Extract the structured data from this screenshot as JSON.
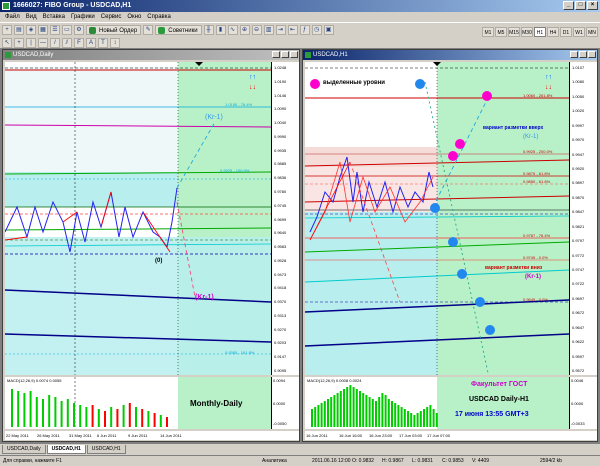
{
  "app": {
    "title": "1666027: FIBO Group - USDCAD,H1"
  },
  "menu": [
    "Файл",
    "Вид",
    "Вставка",
    "Графики",
    "Сервис",
    "Окно",
    "Справка"
  ],
  "toolbar": {
    "new_order_label": "Новый Ордер",
    "advisors_label": "Советники"
  },
  "timeframes": [
    "M1",
    "M5",
    "M15",
    "M30",
    "H1",
    "H4",
    "D1",
    "W1",
    "MN"
  ],
  "active_timeframe": "H1",
  "left_chart": {
    "title": "USDCAD,Daily",
    "price_labels": [
      "1.0248",
      "1.0190",
      "1.0146",
      "1.0090",
      "1.0040",
      "0.9990",
      "0.9935",
      "0.9885",
      "0.9836",
      "0.9780",
      "0.9745",
      "0.9699",
      "0.9640",
      "0.9583",
      "0.9528",
      "0.9473",
      "0.9418",
      "0.9370",
      "0.9313",
      "0.9270",
      "0.9203",
      "0.9147",
      "0.9095"
    ],
    "level_labels": [
      "1.0150 - 76.4%",
      "0.9925 - 100.0%",
      "0.9385 - 161.8%"
    ],
    "label_kr": "(Kr-1)",
    "label_zero": "(0)",
    "label_kr2": "(Kr-1)",
    "macd_label": "MACD(12,26,9) 0.0074 0.0055",
    "macd_scale": [
      "0.0094",
      "0.0000",
      "-0.0050"
    ],
    "dates": [
      "22 May 2011",
      "26 May 2011",
      "31 May 2011",
      "6 Jun 2011",
      "9 Jun 2011",
      "14 Jun 2011"
    ],
    "overlay_text": "Monthly-Daily"
  },
  "right_chart": {
    "title": "USDCAD,H1",
    "price_labels": [
      "1.0107",
      "1.0080",
      "1.0050",
      "1.0020",
      "0.9997",
      "0.9970",
      "0.9947",
      "0.9920",
      "0.9897",
      "0.9870",
      "0.9847",
      "0.9821",
      "0.9797",
      "0.9772",
      "0.9747",
      "0.9722",
      "0.9697",
      "0.9672",
      "0.9647",
      "0.9622",
      "0.9597",
      "0.9572"
    ],
    "level_labels": [
      "1.0060 - 261.8%",
      "0.9925 - 200.0%",
      "0.9875 - 61.8%",
      "0.9850 - 61.8%",
      "0.9787 - 76.4%",
      "0.9745 - 0.0%",
      "0.9645 - 0.0%"
    ],
    "legend_text": "выделенные уровни",
    "label_up": "вариант разметки вверх",
    "label_kr": "(Kr-1)",
    "label_down": "вариант разметки вниз",
    "label_kr2": "(Kr-1)",
    "macd_label": "MACD(12,26,9) 0.0008 0.0024",
    "macd_scale": [
      "0.0046",
      "0.0000",
      "-0.0033"
    ],
    "dates": [
      "16 Jun 2011",
      "16 Jun 16:00",
      "16 Jun 23:00",
      "17 Jun 03:00",
      "17 Jun 07:00"
    ],
    "overlay_line1": "Факультет ГОСТ",
    "overlay_line2": "USDCAD Daily-H1",
    "overlay_line3": "17 июня 13:55 GMT+3"
  },
  "window_tabs": [
    "USDCAD,Daily",
    "USDCAD,H1",
    "USDCAD,H1"
  ],
  "active_window_tab": 1,
  "status": {
    "help": "Для справки, нажмите F1",
    "profile": "Аналитика",
    "datetime": "2011.06.16 12:00",
    "open": "O: 0.9832",
    "high": "H: 0.9867",
    "low": "L: 0.9831",
    "close": "C: 0.9853",
    "volume": "V: 4409",
    "traffic": "2594/2 kb"
  },
  "colors": {
    "green_zone": "#b8f0c8",
    "cyan_zone": "#b8eeee",
    "pink_zone": "#f6dcd8",
    "bullet_magenta": "#ff00cc",
    "bullet_blue": "#2288ee",
    "macd_green": "#00cc00",
    "macd_red": "#ff0000",
    "overlay_purple": "#cc00cc"
  }
}
